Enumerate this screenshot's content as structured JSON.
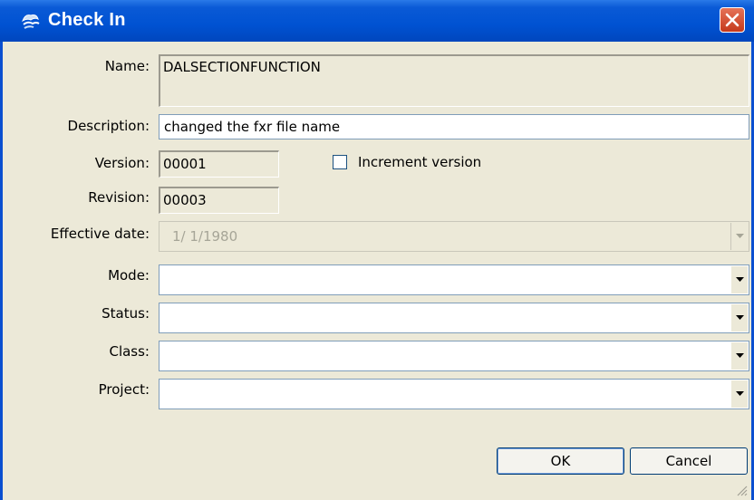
{
  "window": {
    "title": "Check In",
    "icon": "check-in-app-icon"
  },
  "fields": {
    "name": {
      "label": "Name:",
      "value": "DALSECTIONFUNCTION"
    },
    "description": {
      "label": "Description:",
      "value": "changed the fxr file name"
    },
    "version": {
      "label": "Version:",
      "value": "00001"
    },
    "increment": {
      "label": "Increment version",
      "checked": false
    },
    "revision": {
      "label": "Revision:",
      "value": "00003"
    },
    "effective_date": {
      "label": "Effective date:",
      "value": "1/  1/1980",
      "enabled": false
    },
    "mode": {
      "label": "Mode:",
      "value": ""
    },
    "status": {
      "label": "Status:",
      "value": ""
    },
    "class": {
      "label": "Class:",
      "value": ""
    },
    "project": {
      "label": "Project:",
      "value": ""
    }
  },
  "buttons": {
    "ok": "OK",
    "cancel": "Cancel"
  },
  "colors": {
    "titlebar": "#0052d2",
    "dialog_bg": "#ece9d8",
    "close": "#d9532c"
  }
}
